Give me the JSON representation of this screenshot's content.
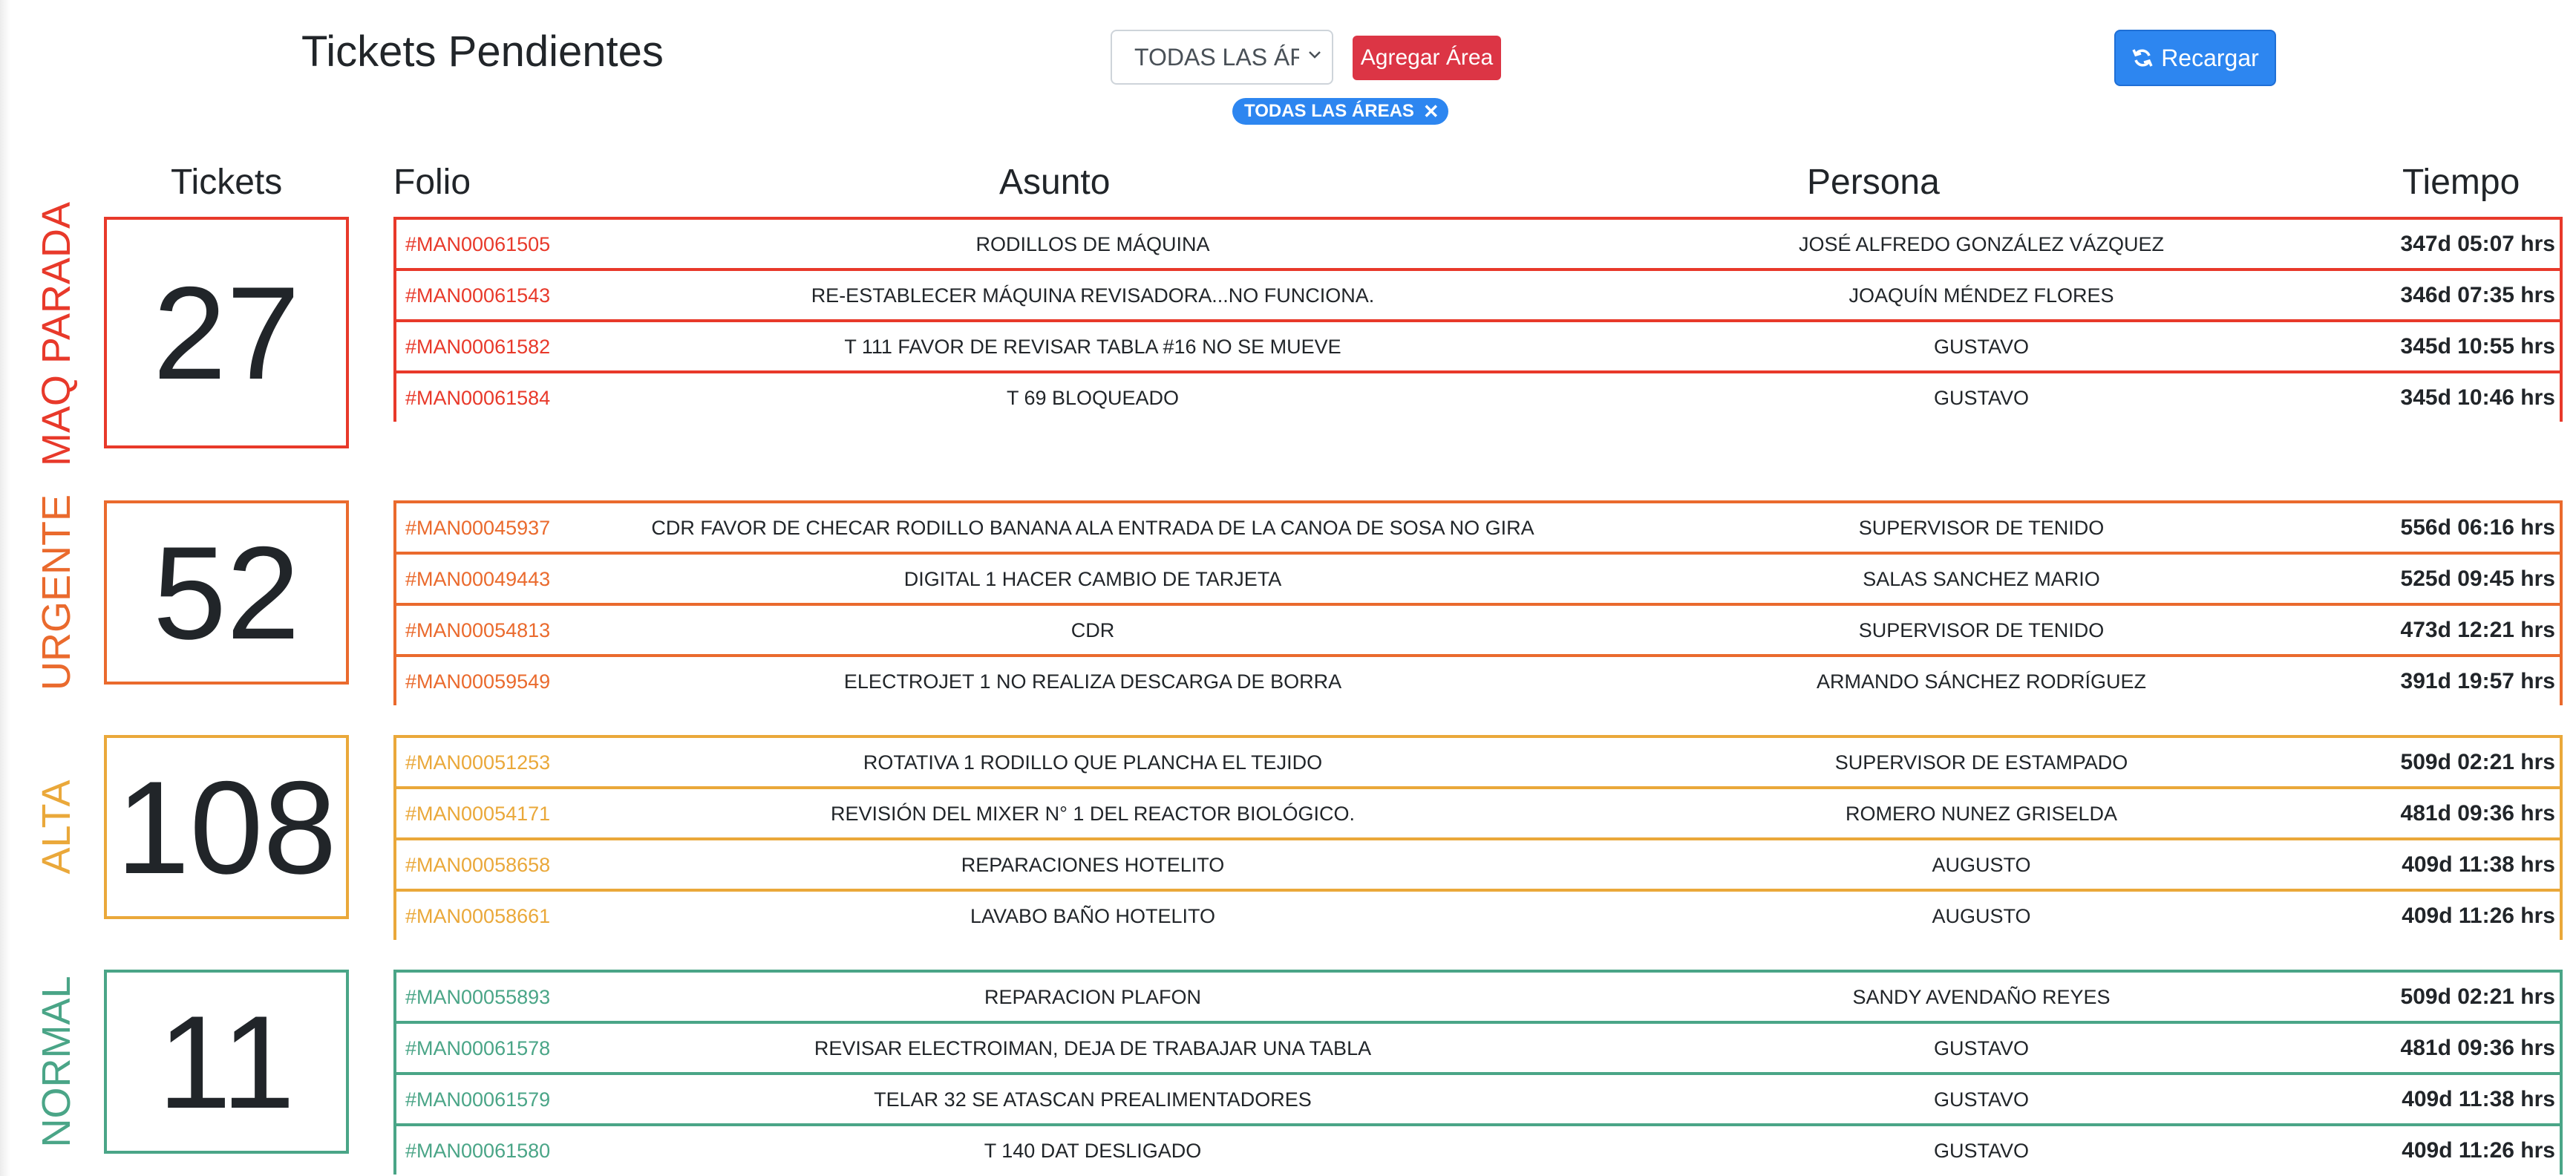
{
  "header": {
    "title": "Tickets Pendientes",
    "area_select_value": "TODAS LAS ÁREAS",
    "add_area_label": "Agregar Área",
    "chip_label": "TODAS LAS ÁREAS",
    "chip_close": "✕",
    "reload_label": "Recargar"
  },
  "columns": {
    "tickets": "Tickets",
    "folio": "Folio",
    "asunto": "Asunto",
    "persona": "Persona",
    "tiempo": "Tiempo"
  },
  "colors": {
    "maq_parada": "#e8392a",
    "urgente": "#ea6a2d",
    "alta": "#eaa83a",
    "normal": "#4aa587",
    "primary": "#2d86f0",
    "danger": "#dc3545"
  },
  "sections": [
    {
      "label": "MAQ PARADA",
      "count": "27",
      "rows": [
        {
          "folio": "#MAN00061505",
          "asunto": "RODILLOS DE MÁQUINA",
          "persona": "JOSÉ ALFREDO GONZÁLEZ VÁZQUEZ",
          "tiempo": "347d 05:07 hrs"
        },
        {
          "folio": "#MAN00061543",
          "asunto": "RE-ESTABLECER MÁQUINA REVISADORA...NO FUNCIONA.",
          "persona": "JOAQUÍN MÉNDEZ FLORES",
          "tiempo": "346d 07:35 hrs"
        },
        {
          "folio": "#MAN00061582",
          "asunto": "T 111 FAVOR DE REVISAR TABLA #16 NO SE MUEVE",
          "persona": "GUSTAVO",
          "tiempo": "345d 10:55 hrs"
        },
        {
          "folio": "#MAN00061584",
          "asunto": "T 69 BLOQUEADO",
          "persona": "GUSTAVO",
          "tiempo": "345d 10:46 hrs"
        }
      ]
    },
    {
      "label": "URGENTE",
      "count": "52",
      "rows": [
        {
          "folio": "#MAN00045937",
          "asunto": "CDR FAVOR DE CHECAR RODILLO BANANA ALA ENTRADA DE LA CANOA DE SOSA NO GIRA",
          "persona": "SUPERVISOR DE TENIDO",
          "tiempo": "556d 06:16 hrs"
        },
        {
          "folio": "#MAN00049443",
          "asunto": "DIGITAL 1 HACER CAMBIO DE TARJETA",
          "persona": "SALAS SANCHEZ MARIO",
          "tiempo": "525d 09:45 hrs"
        },
        {
          "folio": "#MAN00054813",
          "asunto": "CDR",
          "persona": "SUPERVISOR DE TENIDO",
          "tiempo": "473d 12:21 hrs"
        },
        {
          "folio": "#MAN00059549",
          "asunto": "ELECTROJET 1 NO REALIZA DESCARGA DE BORRA",
          "persona": "ARMANDO SÁNCHEZ RODRÍGUEZ",
          "tiempo": "391d 19:57 hrs"
        }
      ]
    },
    {
      "label": "ALTA",
      "count": "108",
      "rows": [
        {
          "folio": "#MAN00051253",
          "asunto": "ROTATIVA 1 RODILLO QUE PLANCHA EL TEJIDO",
          "persona": "SUPERVISOR DE ESTAMPADO",
          "tiempo": "509d 02:21 hrs"
        },
        {
          "folio": "#MAN00054171",
          "asunto": "REVISIÓN DEL MIXER N° 1 DEL REACTOR BIOLÓGICO.",
          "persona": "ROMERO NUNEZ GRISELDA",
          "tiempo": "481d 09:36 hrs"
        },
        {
          "folio": "#MAN00058658",
          "asunto": "REPARACIONES HOTELITO",
          "persona": "AUGUSTO",
          "tiempo": "409d 11:38 hrs"
        },
        {
          "folio": "#MAN00058661",
          "asunto": "LAVABO BAÑO HOTELITO",
          "persona": "AUGUSTO",
          "tiempo": "409d 11:26 hrs"
        }
      ]
    },
    {
      "label": "NORMAL",
      "count": "11",
      "rows": [
        {
          "folio": "#MAN00055893",
          "asunto": "REPARACION PLAFON",
          "persona": "SANDY AVENDAÑO REYES",
          "tiempo": "509d 02:21 hrs"
        },
        {
          "folio": "#MAN00061578",
          "asunto": "REVISAR ELECTROIMAN, DEJA DE TRABAJAR UNA TABLA",
          "persona": "GUSTAVO",
          "tiempo": "481d 09:36 hrs"
        },
        {
          "folio": "#MAN00061579",
          "asunto": "TELAR 32 SE ATASCAN PREALIMENTADORES",
          "persona": "GUSTAVO",
          "tiempo": "409d 11:38 hrs"
        },
        {
          "folio": "#MAN00061580",
          "asunto": "T 140 DAT DESLIGADO",
          "persona": "GUSTAVO",
          "tiempo": "409d 11:26 hrs"
        }
      ]
    }
  ]
}
